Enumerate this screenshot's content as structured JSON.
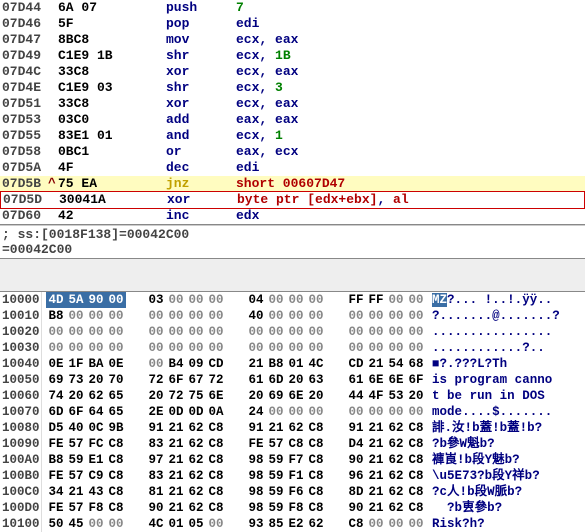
{
  "asm": [
    {
      "addr": "07D44",
      "mark": "",
      "bytes": "6A 07",
      "mnem": "push",
      "ops": [
        [
          "num",
          "7"
        ]
      ]
    },
    {
      "addr": "07D46",
      "mark": "",
      "bytes": "5F",
      "mnem": "pop",
      "ops": [
        [
          "reg",
          "edi"
        ]
      ]
    },
    {
      "addr": "07D47",
      "mark": "",
      "bytes": "8BC8",
      "mnem": "mov",
      "ops": [
        [
          "reg",
          "ecx"
        ],
        [
          "txt",
          ", "
        ],
        [
          "reg",
          "eax"
        ]
      ]
    },
    {
      "addr": "07D49",
      "mark": "",
      "bytes": "C1E9 1B",
      "mnem": "shr",
      "ops": [
        [
          "reg",
          "ecx"
        ],
        [
          "txt",
          ", "
        ],
        [
          "num",
          "1B"
        ]
      ]
    },
    {
      "addr": "07D4C",
      "mark": "",
      "bytes": "33C8",
      "mnem": "xor",
      "ops": [
        [
          "reg",
          "ecx"
        ],
        [
          "txt",
          ", "
        ],
        [
          "reg",
          "eax"
        ]
      ]
    },
    {
      "addr": "07D4E",
      "mark": "",
      "bytes": "C1E9 03",
      "mnem": "shr",
      "ops": [
        [
          "reg",
          "ecx"
        ],
        [
          "txt",
          ", "
        ],
        [
          "num",
          "3"
        ]
      ]
    },
    {
      "addr": "07D51",
      "mark": "",
      "bytes": "33C8",
      "mnem": "xor",
      "ops": [
        [
          "reg",
          "ecx"
        ],
        [
          "txt",
          ", "
        ],
        [
          "reg",
          "eax"
        ]
      ]
    },
    {
      "addr": "07D53",
      "mark": "",
      "bytes": "03C0",
      "mnem": "add",
      "ops": [
        [
          "reg",
          "eax"
        ],
        [
          "txt",
          ", "
        ],
        [
          "reg",
          "eax"
        ]
      ]
    },
    {
      "addr": "07D55",
      "mark": "",
      "bytes": "83E1 01",
      "mnem": "and",
      "ops": [
        [
          "reg",
          "ecx"
        ],
        [
          "txt",
          ", "
        ],
        [
          "num",
          "1"
        ]
      ]
    },
    {
      "addr": "07D58",
      "mark": "",
      "bytes": "0BC1",
      "mnem": "or",
      "ops": [
        [
          "reg",
          "eax"
        ],
        [
          "txt",
          ", "
        ],
        [
          "reg",
          "ecx"
        ]
      ]
    },
    {
      "addr": "07D5A",
      "mark": "",
      "bytes": "4F",
      "mnem": "dec",
      "ops": [
        [
          "reg",
          "edi"
        ]
      ]
    },
    {
      "addr": "07D5B",
      "mark": "^",
      "bytes": "75 EA",
      "mnem": "jnz",
      "ops": [
        [
          "red",
          "short 00607D47"
        ]
      ],
      "style": "jnz"
    },
    {
      "addr": "07D5D",
      "mark": "",
      "bytes": "30041A",
      "mnem": "xor",
      "ops": [
        [
          "red",
          "byte ptr [edx+ebx]"
        ],
        [
          "txt",
          ", "
        ],
        [
          "red",
          "al"
        ]
      ],
      "style": "xorbox"
    },
    {
      "addr": "07D60",
      "mark": "",
      "bytes": "42",
      "mnem": "inc",
      "ops": [
        [
          "reg",
          "edx"
        ]
      ]
    }
  ],
  "status": {
    "line1": "; ss:[0018F138]=00042C00",
    "line2": "=00042C00"
  },
  "hex": [
    {
      "addr": "10000",
      "b": [
        "4D",
        "5A",
        "90",
        "00",
        "03",
        "00",
        "00",
        "00",
        "04",
        "00",
        "00",
        "00",
        "FF",
        "FF",
        "00",
        "00"
      ],
      "sel": [
        0,
        1,
        2,
        3
      ],
      "ascii": "MZ?... !..!.ÿÿ..",
      "asciiSel": [
        0,
        1
      ]
    },
    {
      "addr": "10010",
      "b": [
        "B8",
        "00",
        "00",
        "00",
        "00",
        "00",
        "00",
        "00",
        "40",
        "00",
        "00",
        "00",
        "00",
        "00",
        "00",
        "00"
      ],
      "sel": [],
      "ascii": "?.......@.......?"
    },
    {
      "addr": "10020",
      "b": [
        "00",
        "00",
        "00",
        "00",
        "00",
        "00",
        "00",
        "00",
        "00",
        "00",
        "00",
        "00",
        "00",
        "00",
        "00",
        "00"
      ],
      "sel": [],
      "ascii": "................"
    },
    {
      "addr": "10030",
      "b": [
        "00",
        "00",
        "00",
        "00",
        "00",
        "00",
        "00",
        "00",
        "00",
        "00",
        "00",
        "00",
        "00",
        "00",
        "00",
        "00"
      ],
      "sel": [],
      "ascii": "............?.."
    },
    {
      "addr": "10040",
      "b": [
        "0E",
        "1F",
        "BA",
        "0E",
        "00",
        "B4",
        "09",
        "CD",
        "21",
        "B8",
        "01",
        "4C",
        "CD",
        "21",
        "54",
        "68"
      ],
      "sel": [],
      "ascii": "■?.???L?Th"
    },
    {
      "addr": "10050",
      "b": [
        "69",
        "73",
        "20",
        "70",
        "72",
        "6F",
        "67",
        "72",
        "61",
        "6D",
        "20",
        "63",
        "61",
        "6E",
        "6E",
        "6F"
      ],
      "sel": [],
      "ascii": "is program canno"
    },
    {
      "addr": "10060",
      "b": [
        "74",
        "20",
        "62",
        "65",
        "20",
        "72",
        "75",
        "6E",
        "20",
        "69",
        "6E",
        "20",
        "44",
        "4F",
        "53",
        "20"
      ],
      "sel": [],
      "ascii": "t be run in DOS "
    },
    {
      "addr": "10070",
      "b": [
        "6D",
        "6F",
        "64",
        "65",
        "2E",
        "0D",
        "0D",
        "0A",
        "24",
        "00",
        "00",
        "00",
        "00",
        "00",
        "00",
        "00"
      ],
      "sel": [],
      "ascii": "mode....$......."
    },
    {
      "addr": "10080",
      "b": [
        "D5",
        "40",
        "0C",
        "9B",
        "91",
        "21",
        "62",
        "C8",
        "91",
        "21",
        "62",
        "C8",
        "91",
        "21",
        "62",
        "C8"
      ],
      "sel": [],
      "ascii": "誹.汝!b蓋!b蓋!b?"
    },
    {
      "addr": "10090",
      "b": [
        "FE",
        "57",
        "FC",
        "C8",
        "83",
        "21",
        "62",
        "C8",
        "FE",
        "57",
        "C8",
        "C8",
        "D4",
        "21",
        "62",
        "C8"
      ],
      "sel": [],
      "ascii": "?b參W魁b?"
    },
    {
      "addr": "100A0",
      "b": [
        "B8",
        "59",
        "E1",
        "C8",
        "97",
        "21",
        "62",
        "C8",
        "98",
        "59",
        "F7",
        "C8",
        "90",
        "21",
        "62",
        "C8"
      ],
      "sel": [],
      "ascii": "褲崀!b段Y魅b?"
    },
    {
      "addr": "100B0",
      "b": [
        "FE",
        "57",
        "C9",
        "C8",
        "83",
        "21",
        "62",
        "C8",
        "98",
        "59",
        "F1",
        "C8",
        "96",
        "21",
        "62",
        "C8"
      ],
      "sel": [],
      "ascii": "\\u5E73?b段Y祥b?"
    },
    {
      "addr": "100C0",
      "b": [
        "34",
        "21",
        "43",
        "C8",
        "81",
        "21",
        "62",
        "C8",
        "98",
        "59",
        "F6",
        "C8",
        "8D",
        "21",
        "62",
        "C8"
      ],
      "sel": [],
      "ascii": "?c人!b段W脈b?"
    },
    {
      "addr": "100D0",
      "b": [
        "FE",
        "57",
        "F8",
        "C8",
        "90",
        "21",
        "62",
        "C8",
        "98",
        "59",
        "F8",
        "C8",
        "90",
        "21",
        "62",
        "C8"
      ],
      "sel": [],
      "ascii": "  ?b叀參b?"
    },
    {
      "addr": "10100",
      "b": [
        "50",
        "45",
        "00",
        "00",
        "4C",
        "01",
        "05",
        "00",
        "93",
        "85",
        "E2",
        "62",
        "C8",
        "00",
        "00",
        "00"
      ],
      "sel": [],
      "ascii": "Risk?h?"
    }
  ]
}
